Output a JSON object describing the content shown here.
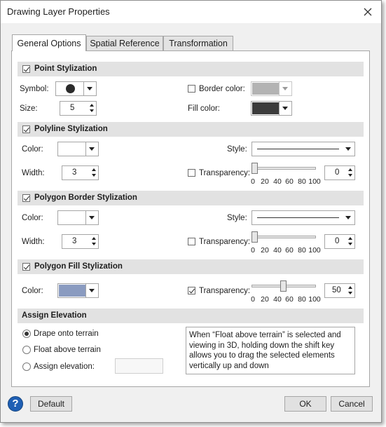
{
  "window": {
    "title": "Drawing Layer Properties"
  },
  "tabs": [
    {
      "label": "General Options",
      "active": true
    },
    {
      "label": "Spatial Reference",
      "active": false
    },
    {
      "label": "Transformation",
      "active": false
    }
  ],
  "point": {
    "title": "Point Stylization",
    "checked": true,
    "symbol_label": "Symbol:",
    "size_label": "Size:",
    "size_value": "5",
    "border_color_label": "Border color:",
    "border_color_checked": false,
    "border_color": "#b3b3b3",
    "fill_color_label": "Fill color:",
    "fill_color": "#3c3c3c"
  },
  "polyline": {
    "title": "Polyline Stylization",
    "checked": true,
    "color_label": "Color:",
    "color": "#ffffff",
    "style_label": "Style:",
    "width_label": "Width:",
    "width_value": "3",
    "transparency_label": "Transparency:",
    "transparency_checked": false,
    "transparency_value": "0"
  },
  "polygon_border": {
    "title": "Polygon Border Stylization",
    "checked": true,
    "color_label": "Color:",
    "color": "#ffffff",
    "style_label": "Style:",
    "width_label": "Width:",
    "width_value": "3",
    "transparency_label": "Transparency:",
    "transparency_checked": false,
    "transparency_value": "0"
  },
  "polygon_fill": {
    "title": "Polygon Fill Stylization",
    "checked": true,
    "color_label": "Color:",
    "color": "#8a9bc0",
    "transparency_label": "Transparency:",
    "transparency_checked": true,
    "transparency_value": "50"
  },
  "slider_ticks": [
    "0",
    "20",
    "40",
    "60",
    "80",
    "100"
  ],
  "elevation": {
    "title": "Assign Elevation",
    "options": [
      {
        "label": "Drape onto terrain",
        "selected": true
      },
      {
        "label": "Float above terrain",
        "selected": false
      },
      {
        "label": "Assign elevation:",
        "selected": false
      }
    ],
    "info_text": "When “Float above terrain” is selected and viewing in 3D, holding down the shift key allows you to drag the selected elements vertically up and down"
  },
  "footer": {
    "help_icon": "question-mark-icon",
    "help_glyph": "?",
    "default_label": "Default",
    "ok_label": "OK",
    "cancel_label": "Cancel"
  }
}
